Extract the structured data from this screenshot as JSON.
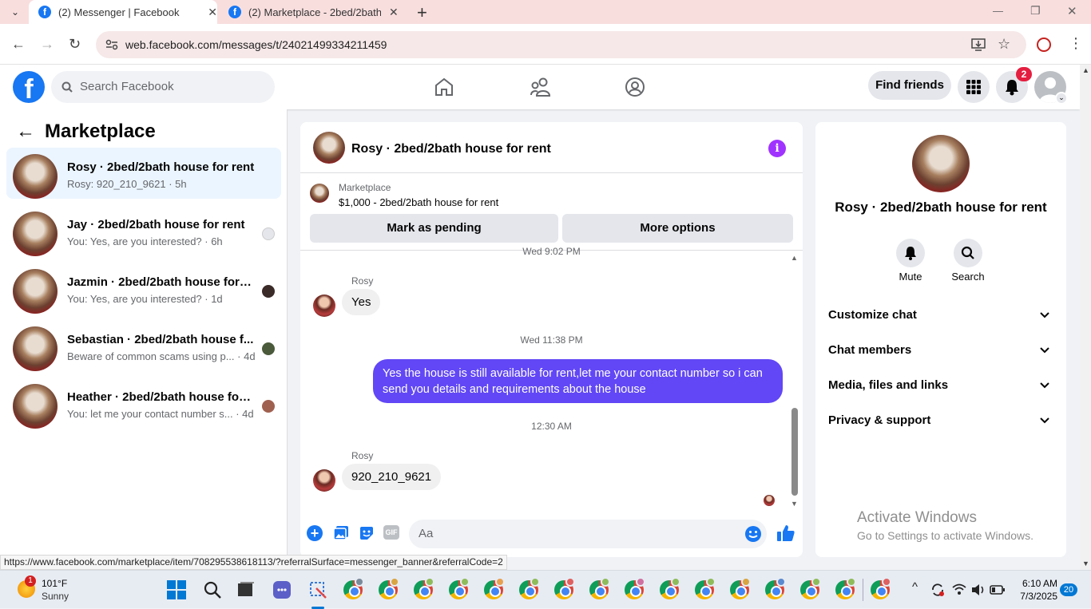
{
  "browser": {
    "tabs": [
      {
        "title": "(2) Messenger | Facebook",
        "close": "✕"
      },
      {
        "title": "(2) Marketplace - 2bed/2bath house",
        "close": "✕"
      }
    ],
    "new_tab": "+",
    "url": "web.facebook.com/messages/t/24021499334211459",
    "window_controls": {
      "minimize": "—",
      "maximize": "❐",
      "close": "✕"
    }
  },
  "fb_header": {
    "logo": "f",
    "search_placeholder": "Search Facebook",
    "find_friends": "Find friends",
    "notification_count": "2"
  },
  "left_panel": {
    "title": "Marketplace",
    "conversations": [
      {
        "name": "Rosy · 2bed/2bath house for rent",
        "preview": "Rosy: 920_210_9621 · 5h"
      },
      {
        "name": "Jay · 2bed/2bath house for rent",
        "preview": "You: Yes, are you interested? · 6h"
      },
      {
        "name": "Jazmin · 2bed/2bath house for r...",
        "preview": "You: Yes, are you interested? · 1d"
      },
      {
        "name": "Sebastian · 2bed/2bath house f...",
        "preview": "Beware of common scams using p... · 4d"
      },
      {
        "name": "Heather · 2bed/2bath house for ...",
        "preview": "You: let me your contact number s... · 4d"
      }
    ]
  },
  "chat": {
    "title": "Rosy · 2bed/2bath house for rent",
    "info_icon": "i",
    "marketplace": {
      "label": "Marketplace",
      "listing": "$1,000 - 2bed/2bath house for rent",
      "mark_pending": "Mark as pending",
      "more_options": "More options"
    },
    "partial_timestamp": "Wed 9:02 PM",
    "messages": [
      {
        "sender": "Rosy",
        "text": "Yes"
      },
      {
        "timestamp": "Wed 11:38 PM"
      },
      {
        "text": "Yes the house is still available for rent,let me your contact number so i can send you details and requirements about the house"
      },
      {
        "timestamp": "12:30 AM"
      },
      {
        "sender": "Rosy",
        "text": "920_210_9621"
      }
    ],
    "composer_placeholder": "Aa",
    "gif_label": "GIF"
  },
  "right_panel": {
    "name": "Rosy · 2bed/2bath house for rent",
    "mute": "Mute",
    "search": "Search",
    "sections": [
      "Customize chat",
      "Chat members",
      "Media, files and links",
      "Privacy & support"
    ]
  },
  "watermark": {
    "line1": "Activate Windows",
    "line2": "Go to Settings to activate Windows."
  },
  "status_url": "https://www.facebook.com/marketplace/item/708295538618113/?referralSurface=messenger_banner&referralCode=2",
  "taskbar": {
    "weather_temp": "101°F",
    "weather_desc": "Sunny",
    "weather_badge": "1",
    "time": "6:10 AM",
    "date": "7/3/2025",
    "notif_count": "20"
  },
  "colors": {
    "fb_blue": "#1877f2",
    "my_bubble": "#6147f5",
    "info_purple": "#a033ff",
    "badge_red": "#e41e3f"
  }
}
